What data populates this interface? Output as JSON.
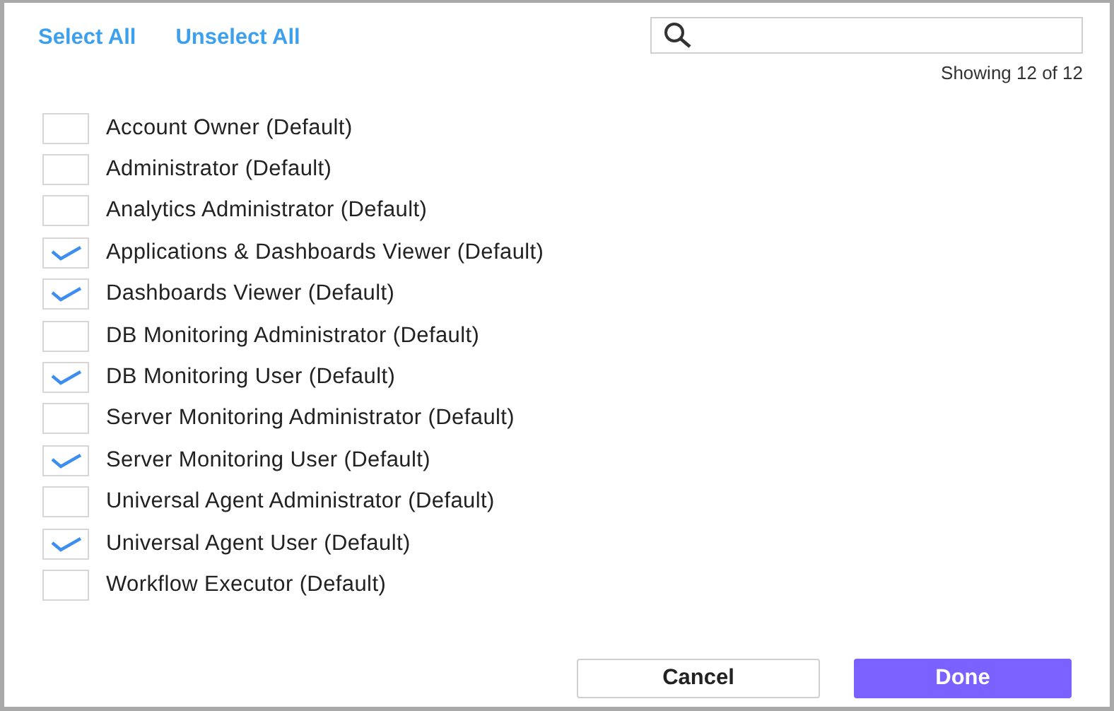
{
  "links": [
    "Select All",
    "Unselect All"
  ],
  "search": {
    "count": "Showing 12 of 12"
  },
  "items": [
    {
      "label": "Account Owner (Default)",
      "checked": false
    },
    {
      "label": "Administrator (Default)",
      "checked": false
    },
    {
      "label": "Analytics Administrator (Default)",
      "checked": false
    },
    {
      "label": "Applications & Dashboards Viewer (Default)",
      "checked": true
    },
    {
      "label": "Dashboards Viewer (Default)",
      "checked": true
    },
    {
      "label": "DB Monitoring Administrator (Default)",
      "checked": false
    },
    {
      "label": "DB Monitoring User (Default)",
      "checked": true
    },
    {
      "label": "Server Monitoring Administrator (Default)",
      "checked": false
    },
    {
      "label": "Server Monitoring User (Default)",
      "checked": true
    },
    {
      "label": "Universal Agent Administrator (Default)",
      "checked": false
    },
    {
      "label": "Universal Agent User (Default)",
      "checked": true
    },
    {
      "label": "Workflow Executor (Default)",
      "checked": false
    }
  ],
  "buttons": [
    {
      "label": "Cancel",
      "kind": "secondary"
    },
    {
      "label": "Done",
      "kind": "primary"
    }
  ]
}
